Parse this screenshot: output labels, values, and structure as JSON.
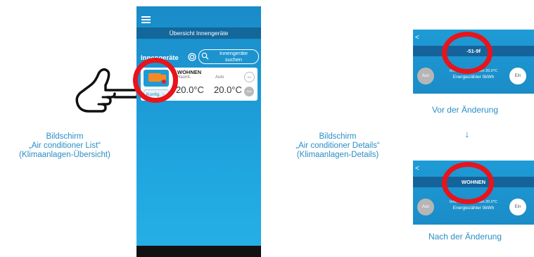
{
  "list_screen": {
    "title": "Übersicht Innengeräte",
    "section_label": "Innengeräte",
    "search_button": "Innengeräte suchen",
    "card": {
      "name": "WOHNEN",
      "room_label": "Raumt.",
      "mode_label": "Auto",
      "room_temp": "20.0°C",
      "set_temp": "20.0°C",
      "konfig_label": "Konfig.",
      "konfig_chevron": ">",
      "on_label": "Ein",
      "off_label": "Aus"
    }
  },
  "captions": {
    "left": [
      "Bildschirm",
      "„Air conditioner List“",
      "(Klimaanlagen-Übersicht)"
    ],
    "middle": [
      "Bildschirm",
      "„Air conditioner Details“",
      "(Klimaanlagen-Details)"
    ],
    "before": "Vor der Änderung",
    "after": "Nach der Änderung",
    "arrow": "↓"
  },
  "detail_before": {
    "back": "<",
    "title": "-51-9f",
    "off": "Aus",
    "on": "Ein",
    "info": "Innen 20.0°C Außen 20.0°C",
    "energy": "Energiezähler 0kWh"
  },
  "detail_after": {
    "back": "<",
    "title": "WOHNEN",
    "off": "Aus",
    "on": "Ein",
    "info": "Innen 20.0°C Außen 20.0°C",
    "energy": "Energiezähler 0kWh"
  },
  "colors": {
    "accent_blue": "#1e9ed9",
    "title_bar": "#13679a",
    "highlight_red": "#e8141c",
    "caption_blue": "#2a8ec4",
    "unit_orange": "#f58a24"
  },
  "icons": [
    "menu-icon",
    "refresh-icon",
    "search-icon",
    "air-conditioner-icon",
    "hand-pointer-icon",
    "back-arrow-icon"
  ]
}
